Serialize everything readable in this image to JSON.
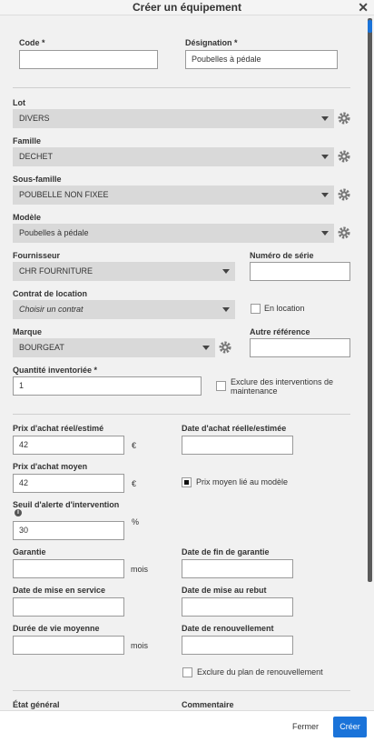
{
  "dialog": {
    "title": "Créer un équipement",
    "close_icon": "close-icon"
  },
  "fields": {
    "code": {
      "label": "Code *",
      "value": ""
    },
    "designation": {
      "label": "Désignation *",
      "value": "Poubelles à pédale"
    },
    "lot": {
      "label": "Lot",
      "value": "DIVERS"
    },
    "famille": {
      "label": "Famille",
      "value": "DECHET"
    },
    "sous_famille": {
      "label": "Sous-famille",
      "value": "POUBELLE NON FIXEE"
    },
    "modele": {
      "label": "Modèle",
      "value": "Poubelles à pédale"
    },
    "fournisseur": {
      "label": "Fournisseur",
      "value": "CHR FOURNITURE"
    },
    "numero_serie": {
      "label": "Numéro de série",
      "value": ""
    },
    "contrat": {
      "label": "Contrat de location",
      "placeholder": "Choisir un contrat"
    },
    "en_location": {
      "label": "En location",
      "checked": false
    },
    "marque": {
      "label": "Marque",
      "value": "BOURGEAT"
    },
    "autre_reference": {
      "label": "Autre référence",
      "value": ""
    },
    "quantite": {
      "label": "Quantité inventoriée *",
      "value": "1"
    },
    "exclure_interventions": {
      "label": "Exclure des interventions de maintenance",
      "checked": false
    },
    "prix_achat": {
      "label": "Prix d'achat réel/estimé",
      "value": "42",
      "unit": "€"
    },
    "date_achat": {
      "label": "Date d'achat réelle/estimée",
      "value": ""
    },
    "prix_moyen": {
      "label": "Prix d'achat moyen",
      "value": "42",
      "unit": "€"
    },
    "prix_moyen_lie": {
      "label": "Prix moyen lié au modèle",
      "checked": true
    },
    "seuil_alerte": {
      "label": "Seuil d'alerte d'intervention",
      "value": "30",
      "unit": "%"
    },
    "garantie": {
      "label": "Garantie",
      "value": "",
      "unit": "mois"
    },
    "date_fin_garantie": {
      "label": "Date de fin de garantie",
      "value": ""
    },
    "date_mise_service": {
      "label": "Date de mise en service",
      "value": ""
    },
    "date_mise_rebut": {
      "label": "Date de mise au rebut",
      "value": ""
    },
    "duree_vie": {
      "label": "Durée de vie moyenne",
      "value": "",
      "unit": "mois"
    },
    "date_renouvellement": {
      "label": "Date de renouvellement",
      "value": ""
    },
    "exclure_renouvellement": {
      "label": "Exclure du plan de renouvellement",
      "checked": false
    },
    "etat_general": {
      "label": "État général"
    },
    "commentaire": {
      "label": "Commentaire"
    }
  },
  "footer": {
    "close_label": "Fermer",
    "create_label": "Créer"
  },
  "colors": {
    "primary": "#1a73d9",
    "select_bg": "#d9d9d9"
  }
}
